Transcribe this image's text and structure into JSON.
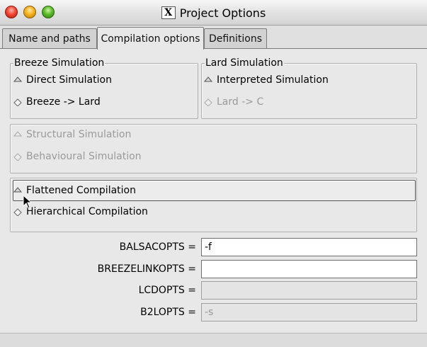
{
  "window": {
    "title": "Project Options",
    "title_icon": "X-icon"
  },
  "tabs": [
    {
      "label": "Name and paths",
      "active": false
    },
    {
      "label": "Compilation options",
      "active": true
    },
    {
      "label": "Definitions",
      "active": false
    }
  ],
  "breeze_group": {
    "legend": "Breeze Simulation",
    "options": [
      {
        "label": "Direct Simulation",
        "selected": true,
        "enabled": true
      },
      {
        "label": "Breeze -> Lard",
        "selected": false,
        "enabled": true
      }
    ]
  },
  "lard_group": {
    "legend": "Lard Simulation",
    "options": [
      {
        "label": "Interpreted Simulation",
        "selected": true,
        "enabled": true
      },
      {
        "label": "Lard -> C",
        "selected": false,
        "enabled": false
      }
    ]
  },
  "simulation_group": {
    "options": [
      {
        "label": "Structural Simulation",
        "selected": true,
        "enabled": false
      },
      {
        "label": "Behavioural Simulation",
        "selected": false,
        "enabled": false
      }
    ]
  },
  "compilation_group": {
    "options": [
      {
        "label": "Flattened Compilation",
        "selected": true,
        "enabled": true
      },
      {
        "label": "Hierarchical Compilation",
        "selected": false,
        "enabled": true
      }
    ]
  },
  "fields": [
    {
      "label": "BALSACOPTS =",
      "value": "-f",
      "enabled": true
    },
    {
      "label": "BREEZELINKOPTS =",
      "value": "",
      "enabled": true
    },
    {
      "label": "LCDOPTS =",
      "value": "",
      "enabled": false
    },
    {
      "label": "B2LOPTS =",
      "value": "-s",
      "enabled": false
    }
  ],
  "colors": {
    "close": "#f24a35",
    "minimize": "#f6b21f",
    "zoom": "#5cbb2a",
    "background": "#e8e8e8",
    "disabled_text": "#9a9a9a"
  }
}
